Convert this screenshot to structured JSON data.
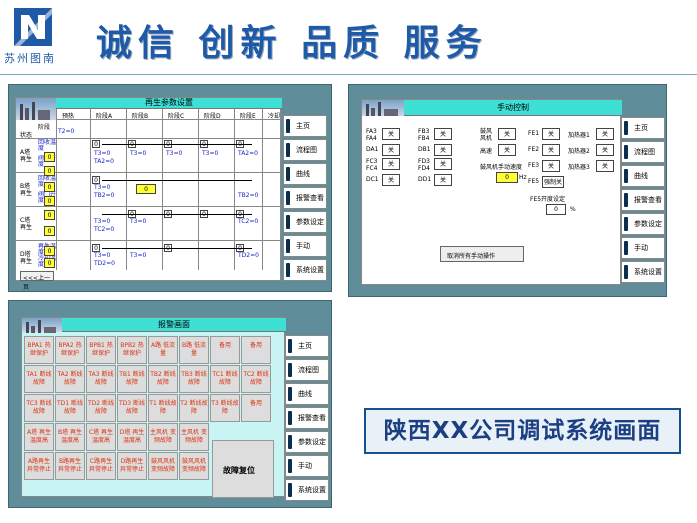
{
  "header": {
    "logo_text": "苏州图南",
    "slogan": "诚信 创新 品质 服务"
  },
  "regen": {
    "title": "再生参数设置",
    "corner_top": "阶段",
    "corner_bottom": "状态",
    "cols": [
      "预热",
      "阶段A",
      "阶段B",
      "阶段C",
      "阶段D",
      "阶段E",
      "冷却"
    ],
    "rows": [
      "A塔再生",
      "B塔再生",
      "C塔再生",
      "D塔再生"
    ],
    "t_values": [
      "T2=0",
      "T3=0",
      "T3=0",
      "T3=0",
      "T3=0",
      "T3=0",
      "TA2=0"
    ],
    "t2_values": [
      "TA2=0",
      "TA2=0",
      "TB2=0",
      "TC2=0",
      "TD2=0"
    ],
    "zero": "0",
    "prev_btn": "<<<上一页",
    "side_labels": [
      "回收温度",
      "阀门开度",
      "回收温度",
      "阀门开度",
      "再生温度",
      "冷却温度"
    ]
  },
  "manual": {
    "title": "手动控制",
    "left": [
      {
        "label": "FA3 FA4",
        "val": "关"
      },
      {
        "label": "FB3 FB4",
        "val": "关"
      },
      {
        "label": "DA1",
        "val": "关"
      },
      {
        "label": "DB1",
        "val": "关"
      },
      {
        "label": "FC3 FC4",
        "val": "关"
      },
      {
        "label": "FD3 FD4",
        "val": "关"
      },
      {
        "label": "DC1",
        "val": "关"
      },
      {
        "label": "DD1",
        "val": "关"
      }
    ],
    "mid": [
      {
        "label": "鼓风 风机",
        "val": "关"
      },
      {
        "label": "高速",
        "val": "关"
      }
    ],
    "speed_label": "鼓风机手动速度",
    "speed_val": "0",
    "speed_unit": "Hz",
    "right": [
      {
        "label": "FE1",
        "val": "关"
      },
      {
        "label": "FE2",
        "val": "关"
      },
      {
        "label": "FE3",
        "val": "关"
      },
      {
        "label": "FE5",
        "val": "强制关"
      }
    ],
    "heaters": [
      {
        "label": "加热器1",
        "val": "关"
      },
      {
        "label": "加热器2",
        "val": "关"
      },
      {
        "label": "加热器3",
        "val": "关"
      }
    ],
    "fe5_label": "FE5开度设定",
    "fe5_val": "0",
    "fe5_unit": "%",
    "cancel": "取消所有手动操作"
  },
  "nav": [
    "主页",
    "流程图",
    "曲线",
    "报警查看",
    "参数设定",
    "手动",
    "系统设置"
  ],
  "alarm": {
    "title": "报警画面",
    "cells": [
      [
        "BPA1 热继保护",
        "BPA2 热继保护",
        "BPB1 热继保护",
        "BPB2 热继保护",
        "A路 低流量",
        "B路 低流量",
        "备用",
        "备用"
      ],
      [
        "TA1 断线故障",
        "TA2 断线故障",
        "TA3 断线故障",
        "TB1 断线故障",
        "TB2 断线故障",
        "TB3 断线故障",
        "TC1 断线故障",
        "TC2 断线故障"
      ],
      [
        "TC3 断线故障",
        "TD1 断线故障",
        "TD2 断线故障",
        "TD3 断线故障",
        "T1 断线故障",
        "T2 断线故障",
        "T3 断线故障",
        "备用"
      ],
      [
        "A塔 再生温度高",
        "B塔 再生温度高",
        "C塔 再生温度高",
        "D塔 再生温度高",
        "主风机 变频故障",
        "主风机 变频故障"
      ],
      [
        "A路再生 异常停止",
        "B路再生 异常停止",
        "C路再生 异常停止",
        "D路再生 异常停止",
        "鼓风风机 变频故障",
        "鼓风风机 变频故障"
      ]
    ],
    "reset": "故障复位"
  },
  "caption": "陕西XX公司调试系统画面"
}
